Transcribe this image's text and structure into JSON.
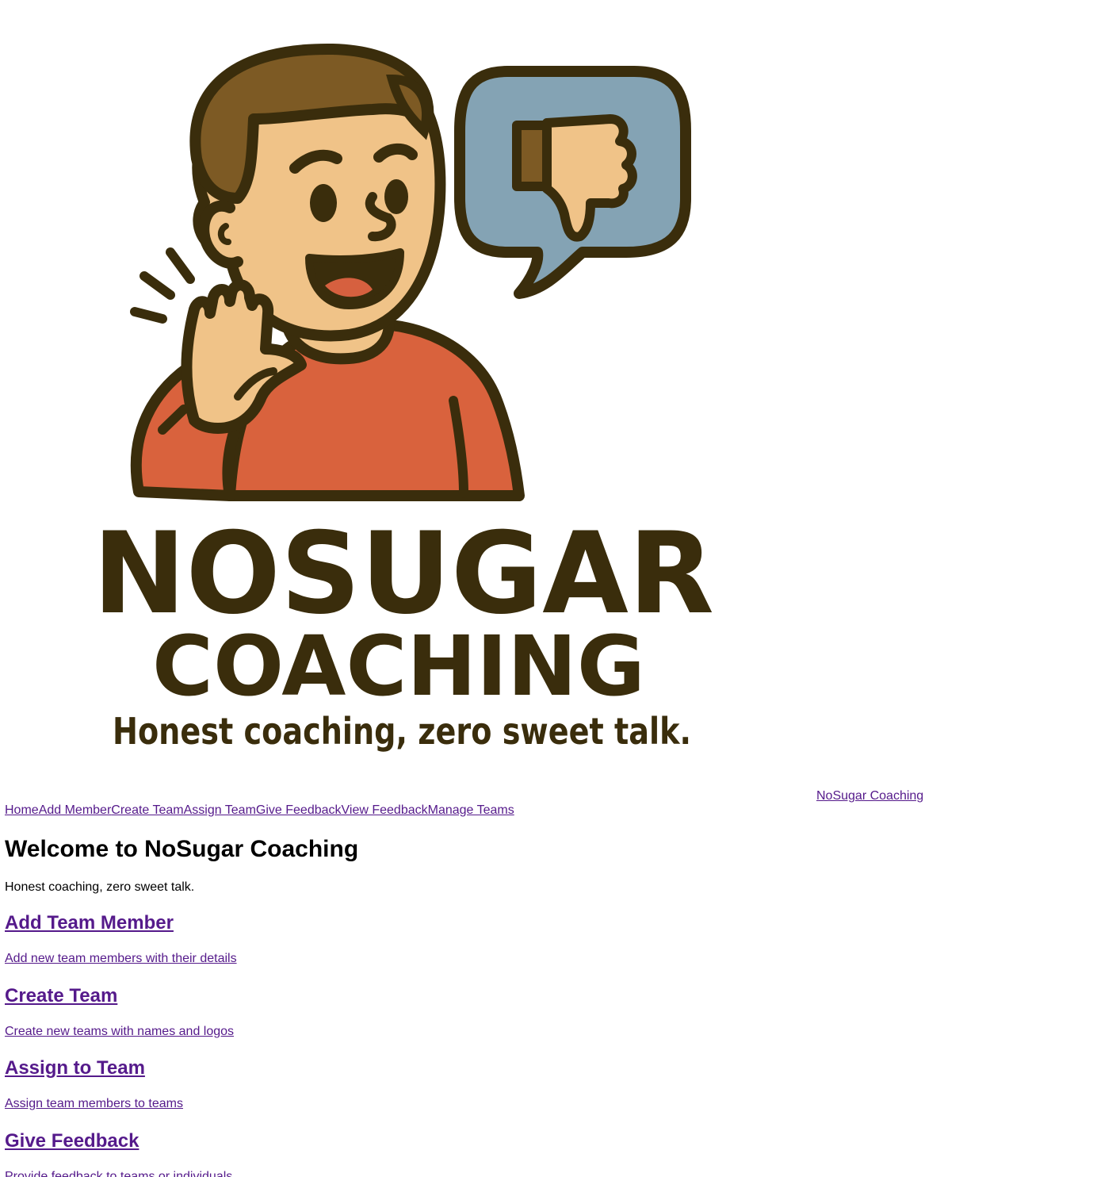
{
  "logo": {
    "name": "NOSUGAR",
    "subname": "COACHING",
    "tagline": "Honest coaching, zero sweet talk.",
    "colors": {
      "outline": "#3a2d0c",
      "skin": "#f0c388",
      "hair": "#7d5a24",
      "shirt": "#d9623d",
      "bubble": "#84a3b4",
      "mouth": "#d6603f"
    }
  },
  "header": {
    "brand_link": "NoSugar Coaching"
  },
  "nav": {
    "items": [
      "Home",
      "Add Member",
      "Create Team",
      "Assign Team",
      "Give Feedback",
      "View Feedback",
      "Manage Teams"
    ]
  },
  "main": {
    "title": "Welcome to NoSugar Coaching",
    "subtitle": "Honest coaching, zero sweet talk.",
    "cards": [
      {
        "title": "Add Team Member",
        "desc": "Add new team members with their details"
      },
      {
        "title": "Create Team",
        "desc": "Create new teams with names and logos"
      },
      {
        "title": "Assign to Team",
        "desc": "Assign team members to teams"
      },
      {
        "title": "Give Feedback",
        "desc": "Provide feedback to teams or individuals"
      }
    ]
  },
  "colors": {
    "link": "#551a8b",
    "text": "#000000",
    "background": "#ffffff"
  }
}
